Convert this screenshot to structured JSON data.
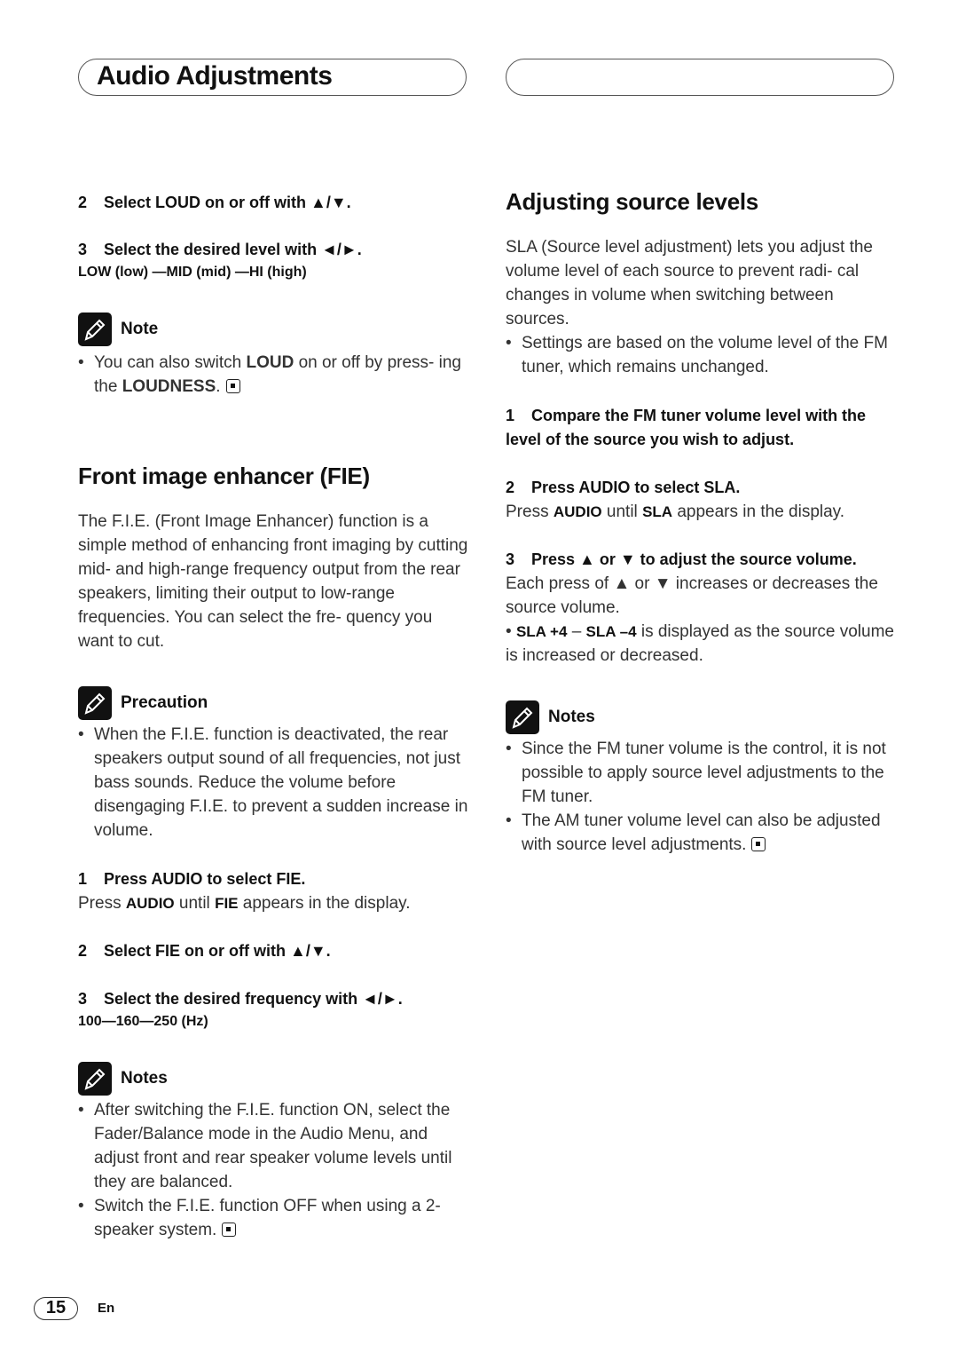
{
  "header": {
    "title": "Audio Adjustments",
    "right_box_text": ""
  },
  "left": {
    "loud_step2": {
      "num": "2",
      "text": "Select LOUD on or off with ▲/▼."
    },
    "loud_step3": {
      "num": "3",
      "text": "Select the desired level with ◄/►."
    },
    "loud_levels": "LOW (low) —MID (mid) —HI (high)",
    "loud_note": {
      "label": "Note",
      "bullet_pre": "You can also switch ",
      "bullet_b1": "LOUD",
      "bullet_mid": " on or off by press- ing the ",
      "bullet_b2": "LOUDNESS",
      "bullet_post": "."
    },
    "fie_heading": "Front image enhancer (FIE)",
    "fie_intro": "The F.I.E. (Front Image Enhancer) function is a simple method of enhancing front imaging by cutting mid- and high-range frequency output from the rear speakers, limiting their output to low-range frequencies. You can select the fre- quency you want to cut.",
    "precaution": {
      "label": "Precaution",
      "bullet": "When the F.I.E. function is deactivated, the rear speakers output sound of all frequencies, not just bass sounds. Reduce the volume before disengaging F.I.E. to prevent a sudden increase in volume."
    },
    "fie_step1": {
      "num": "1",
      "text": "Press AUDIO to select FIE."
    },
    "fie_step1_desc": {
      "pre": "Press ",
      "b1": "AUDIO",
      "mid": " until ",
      "b2": "FIE",
      "post": " appears in the display."
    },
    "fie_step2": {
      "num": "2",
      "text": "Select FIE on or off with ▲/▼."
    },
    "fie_step3": {
      "num": "3",
      "text": "Select the desired frequency with ◄/►."
    },
    "fie_freqs": "100—160—250 (Hz)",
    "fie_notes": {
      "label": "Notes",
      "bullets": [
        "After switching the F.I.E. function ON, select the Fader/Balance mode in the Audio Menu, and adjust front and rear speaker volume levels until they are balanced.",
        "Switch the F.I.E. function OFF when using a 2- speaker system."
      ]
    }
  },
  "right": {
    "sla_heading": "Adjusting source levels",
    "sla_intro": "SLA (Source level adjustment) lets you adjust the volume level of each source to prevent radi- cal changes in volume when switching between sources.",
    "sla_bullet": "Settings are based on the volume level of the FM tuner, which remains unchanged.",
    "step1": {
      "num": "1",
      "text": "Compare the FM tuner volume level with the level of the source you wish to adjust."
    },
    "step2": {
      "num": "2",
      "text": "Press AUDIO to select SLA."
    },
    "step2_desc": {
      "pre": "Press ",
      "b1": "AUDIO",
      "mid": " until ",
      "b2": "SLA",
      "post": " appears in the display."
    },
    "step3": {
      "num": "3",
      "text": "Press ▲ or ▼ to adjust the source volume."
    },
    "step3_desc": "Each press of ▲ or ▼ increases or decreases the source volume.",
    "step3_bullet": {
      "b1": "SLA +4",
      "mid": " – ",
      "b2": "SLA –4",
      "post": " is displayed as the source volume is increased or decreased."
    },
    "notes": {
      "label": "Notes",
      "bullets": [
        "Since the FM tuner volume is the control, it is not possible to apply source level adjustments to the FM tuner.",
        "The AM tuner volume level can also be adjusted with source level adjustments."
      ]
    }
  },
  "footer": {
    "page_number": "15",
    "language": "En"
  }
}
